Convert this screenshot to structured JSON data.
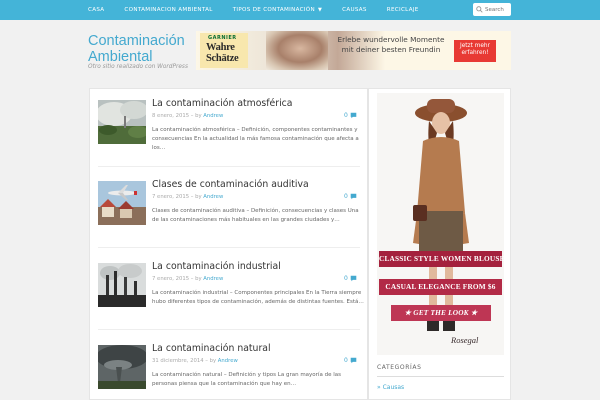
{
  "nav": {
    "items": [
      {
        "label": "Casa",
        "dropdown": false
      },
      {
        "label": "Contaminacion Ambiental",
        "dropdown": false
      },
      {
        "label": "Tipos de contaminación",
        "dropdown": true
      },
      {
        "label": "Causas",
        "dropdown": false
      },
      {
        "label": "Reciclaje",
        "dropdown": false
      }
    ],
    "search_placeholder": "Search",
    "bar_color": "#44b4d8"
  },
  "site": {
    "title": "Contaminación Ambiental",
    "description": "Otro sitio realizado con WordPress"
  },
  "banner_ad": {
    "brand": "GARNIER",
    "product_line1": "Wahre",
    "product_line2": "Schätze",
    "copy": "Erlebe wundervolle Momente mit deiner besten Freundin",
    "cta": "Jetzt mehr erfahren!"
  },
  "posts": [
    {
      "title": "La contaminación atmosférica",
      "date": "8 enero, 2015",
      "author": "Andrew",
      "comments": "0",
      "excerpt": "La contaminación atmosférica – Definición, componentes contaminantes y consecuencias En la actualidad la más famosa contaminación que afecta a los…",
      "image": "smoke-landscape"
    },
    {
      "title": "Clases de contaminación auditiva",
      "date": "7 enero, 2015",
      "author": "Andrew",
      "comments": "0",
      "excerpt": "Clases de contaminación auditiva – Definición, consecuencias y clases Una de las contaminaciones más habituales en las grandes ciudades y…",
      "image": "airplane-over-houses"
    },
    {
      "title": "La contaminación industrial",
      "date": "7 enero, 2015",
      "author": "Andrew",
      "comments": "0",
      "excerpt": "La contaminación industrial – Componentes principales En la Tierra siempre hubo diferentes tipos de contaminación, además de distintas fuentes. Está…",
      "image": "factory-chimneys"
    },
    {
      "title": "La contaminación natural",
      "date": "31 diciembre, 2014",
      "author": "Andrew",
      "comments": "0",
      "excerpt": "La contaminación natural – Definición y tipos La gran mayoría de las personas piensa que la contaminación que hay en…",
      "image": "storm-clouds"
    }
  ],
  "meta_sep": " – by ",
  "sidebar_ad": {
    "ribbon1": "CLASSIC STYLE WOMEN BLOUSE",
    "ribbon2": "CASUAL ELEGANCE FROM $6",
    "ribbon3": "★ GET THE LOOK ★",
    "brand": "Rosegal"
  },
  "sidebar": {
    "heading": "Categorías",
    "links": [
      "» Causas"
    ]
  }
}
